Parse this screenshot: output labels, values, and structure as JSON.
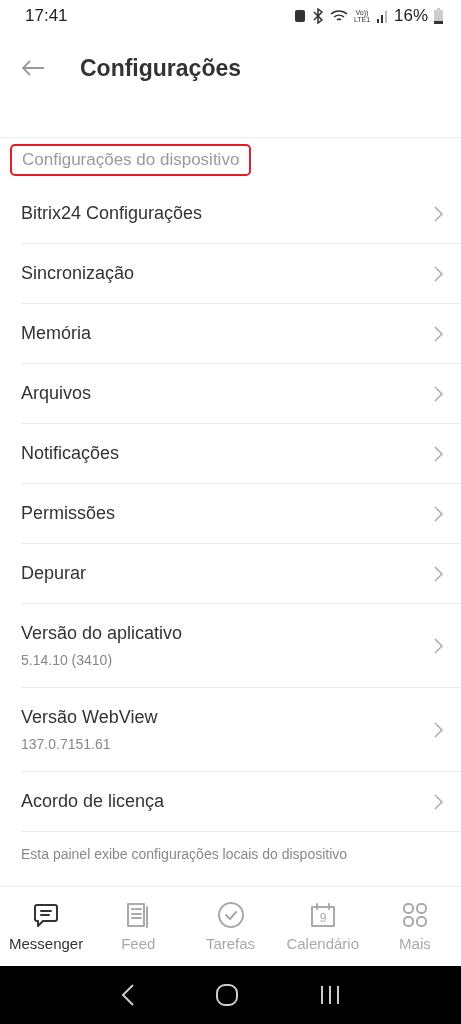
{
  "status_bar": {
    "time": "17:41",
    "network": "Vo)) LTE1",
    "battery": "16%"
  },
  "header": {
    "title": "Configurações"
  },
  "section": {
    "title": "Configurações do dispositivo",
    "highlighted": true
  },
  "items": [
    {
      "label": "Bitrix24 Configurações"
    },
    {
      "label": "Sincronização"
    },
    {
      "label": "Memória"
    },
    {
      "label": "Arquivos"
    },
    {
      "label": "Notificações"
    },
    {
      "label": "Permissões"
    },
    {
      "label": "Depurar"
    },
    {
      "label": "Versão do aplicativo",
      "subtitle": "5.14.10 (3410)"
    },
    {
      "label": "Versão WebView",
      "subtitle": "137.0.7151.61"
    },
    {
      "label": "Acordo de licença"
    }
  ],
  "footnote": "Esta painel exibe configurações locais do dispositivo",
  "tab_bar": [
    {
      "label": "Messenger",
      "kind": "chat",
      "selected": true
    },
    {
      "label": "Feed",
      "kind": "feed",
      "selected": false
    },
    {
      "label": "Tarefas",
      "kind": "check",
      "selected": false
    },
    {
      "label": "Calendário",
      "kind": "calendar",
      "selected": false,
      "calendar_day": "9"
    },
    {
      "label": "Mais",
      "kind": "grid",
      "selected": false
    }
  ]
}
